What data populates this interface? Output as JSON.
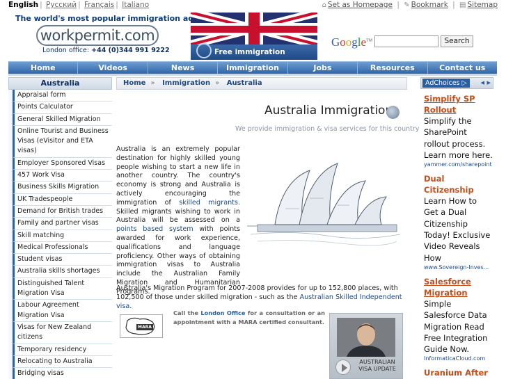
{
  "languages": [
    {
      "label": "English",
      "selected": true
    },
    {
      "label": "Русский",
      "selected": false
    },
    {
      "label": "Français",
      "selected": false
    },
    {
      "label": "Italiano",
      "selected": false
    }
  ],
  "toplinks": {
    "set_homepage": "Set as Homepage",
    "bookmark": "Bookmark",
    "sitemap": "Sitemap"
  },
  "header": {
    "tagline": "The world's most popular immigration advice site",
    "logo": "workpermit.com",
    "office_label": "London office:",
    "office_phone": "+44 (0)344 991 9222",
    "banner_text": "Free immigration assessment"
  },
  "search": {
    "google_letters": [
      "G",
      "o",
      "o",
      "g",
      "l",
      "e"
    ],
    "tm": "TM",
    "button": "Search",
    "value": ""
  },
  "nav": [
    "Home",
    "Videos",
    "News",
    "Immigration",
    "Jobs",
    "Resources",
    "Contact us"
  ],
  "sidebar": {
    "title": "Australia",
    "items": [
      "Appraisal form",
      "Points Calculator",
      "General Skilled Migration",
      "Online Tourist and Business Visas (eVisitor and ETA visas)",
      "Employer Sponsored Visas",
      "457 Work Visa",
      "Business Skills Migration",
      "UK Tradespeople",
      "Demand for British trades",
      "Family and partner visas",
      "Skill matching",
      "Medical Professionals",
      "Student visas",
      "Australia skills shortages",
      "Distinguished Talent Migration Visa",
      "Labour Agreement Migration Visa",
      "Visas for New Zealand citizens",
      "Temporary residency",
      "Relocating to Australia",
      "Bridging visas"
    ]
  },
  "breadcrumb": [
    "Home",
    "Immigration",
    "Australia"
  ],
  "main": {
    "title": "Australia Immigration",
    "subtitle": "We provide immigration & visa services for this country",
    "para1_a": "Australia is an extremely popular destination for highly skilled young people wishing to start a new life in another country. The country's economy is strong and Australia is actively encouraging the immigration of ",
    "para1_link1": "skilled migrants",
    "para1_b": ". Skilled migrants wishing to work in Australia will be assessed on a ",
    "para1_link2": "points based system",
    "para1_c": " with points awarded for work experience, qualifications and language proficiency. Other ways of obtaining immigration visas to Australia include the Australian Family Migration and Humanitarian Programs.",
    "para2_a": "Australia's Migration Program for 2007-2008 provides for up to 152,800 places, with 102,500 of those under skilled migration - such as the ",
    "para2_link": "Australian Skilled Independent visa",
    "para2_b": ".",
    "call_a": "Call the ",
    "call_link": "London Office",
    "call_b": " for a consultation or an appointment with a MARA certified consultant.",
    "mara_label": "MARA",
    "video_caption": "AUSTRALIAN VISA UPDATE"
  },
  "ads": {
    "adchoices": "AdChoices",
    "items": [
      {
        "title": "Simplify SP Rollout",
        "desc": "Simplify the SharePoint rollout process. Learn more here.",
        "url": "yammer.com/sharepoint",
        "underline": true
      },
      {
        "title": "Dual Citizenship",
        "desc": "Learn How to Get a Dual Citizenship Today! Exclusive Video Reveals How",
        "url": "www.Sovereign-Inves...",
        "underline": false
      },
      {
        "title": "Salesforce Migration",
        "desc": "Simple Salesforce Data Migration Read Free Integration Guide Now.",
        "url": "InformaticaCloud.com",
        "underline": true
      },
      {
        "title": "Uranium After",
        "desc": "",
        "url": "",
        "underline": false
      }
    ]
  },
  "colors": {
    "nav_blue": "#2e66a8",
    "ad_title": "#c44d1a",
    "link": "#1a4a8a"
  }
}
